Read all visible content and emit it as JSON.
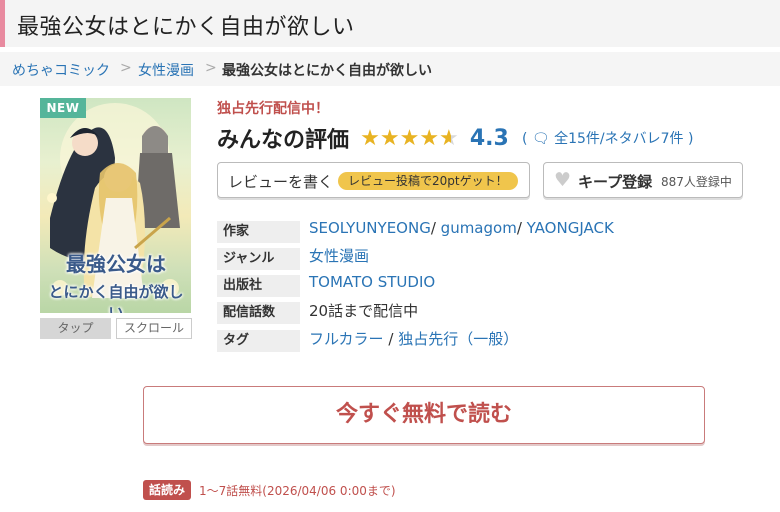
{
  "page": {
    "title": "最強公女はとにかく自由が欲しい"
  },
  "breadcrumb": {
    "items": [
      "めちゃコミック",
      "女性漫画",
      "最強公女はとにかく自由が欲しい"
    ],
    "separator": ">"
  },
  "cover": {
    "badge": "NEW",
    "title_line1": "最強公女は",
    "title_line2": "とにかく自由が欲しい",
    "tap_label": "タップ",
    "scroll_label": "スクロール"
  },
  "book": {
    "exclusive": "独占先行配信中！",
    "rating_title": "みんなの評価",
    "rating_value": 4.3,
    "rating_score": "4.3",
    "rating_counts": "( 🗨 全15件/ネタバレ7件 )",
    "review_button": "レビューを書く",
    "review_bonus": "レビュー投稿で20ptゲット！",
    "keep_button": "キープ登録",
    "keep_count": "887人登録中"
  },
  "info": {
    "author_label": "作家",
    "authors": [
      "SEOLYUNYEONG",
      "gumagom",
      "YAONGJACK"
    ],
    "author_sep": "/",
    "genre_label": "ジャンル",
    "genre": "女性漫画",
    "publisher_label": "出版社",
    "publisher": "TOMATO STUDIO",
    "episodes_label": "配信話数",
    "episodes": "20話まで配信中",
    "tags_label": "タグ",
    "tags": [
      "フルカラー",
      "独占先行（一般）"
    ],
    "tag_sep": "/"
  },
  "cta": {
    "read_button": "今すぐ無料で読む",
    "free_badge": "話読み",
    "free_text": "1〜7話無料(2026/04/06 0:00まで)"
  },
  "colors": {
    "link": "#2a74b5",
    "accent_red": "#c0504d",
    "star": "#e8b322",
    "new_badge": "#55b59a",
    "bonus_pill": "#f0c54c"
  }
}
